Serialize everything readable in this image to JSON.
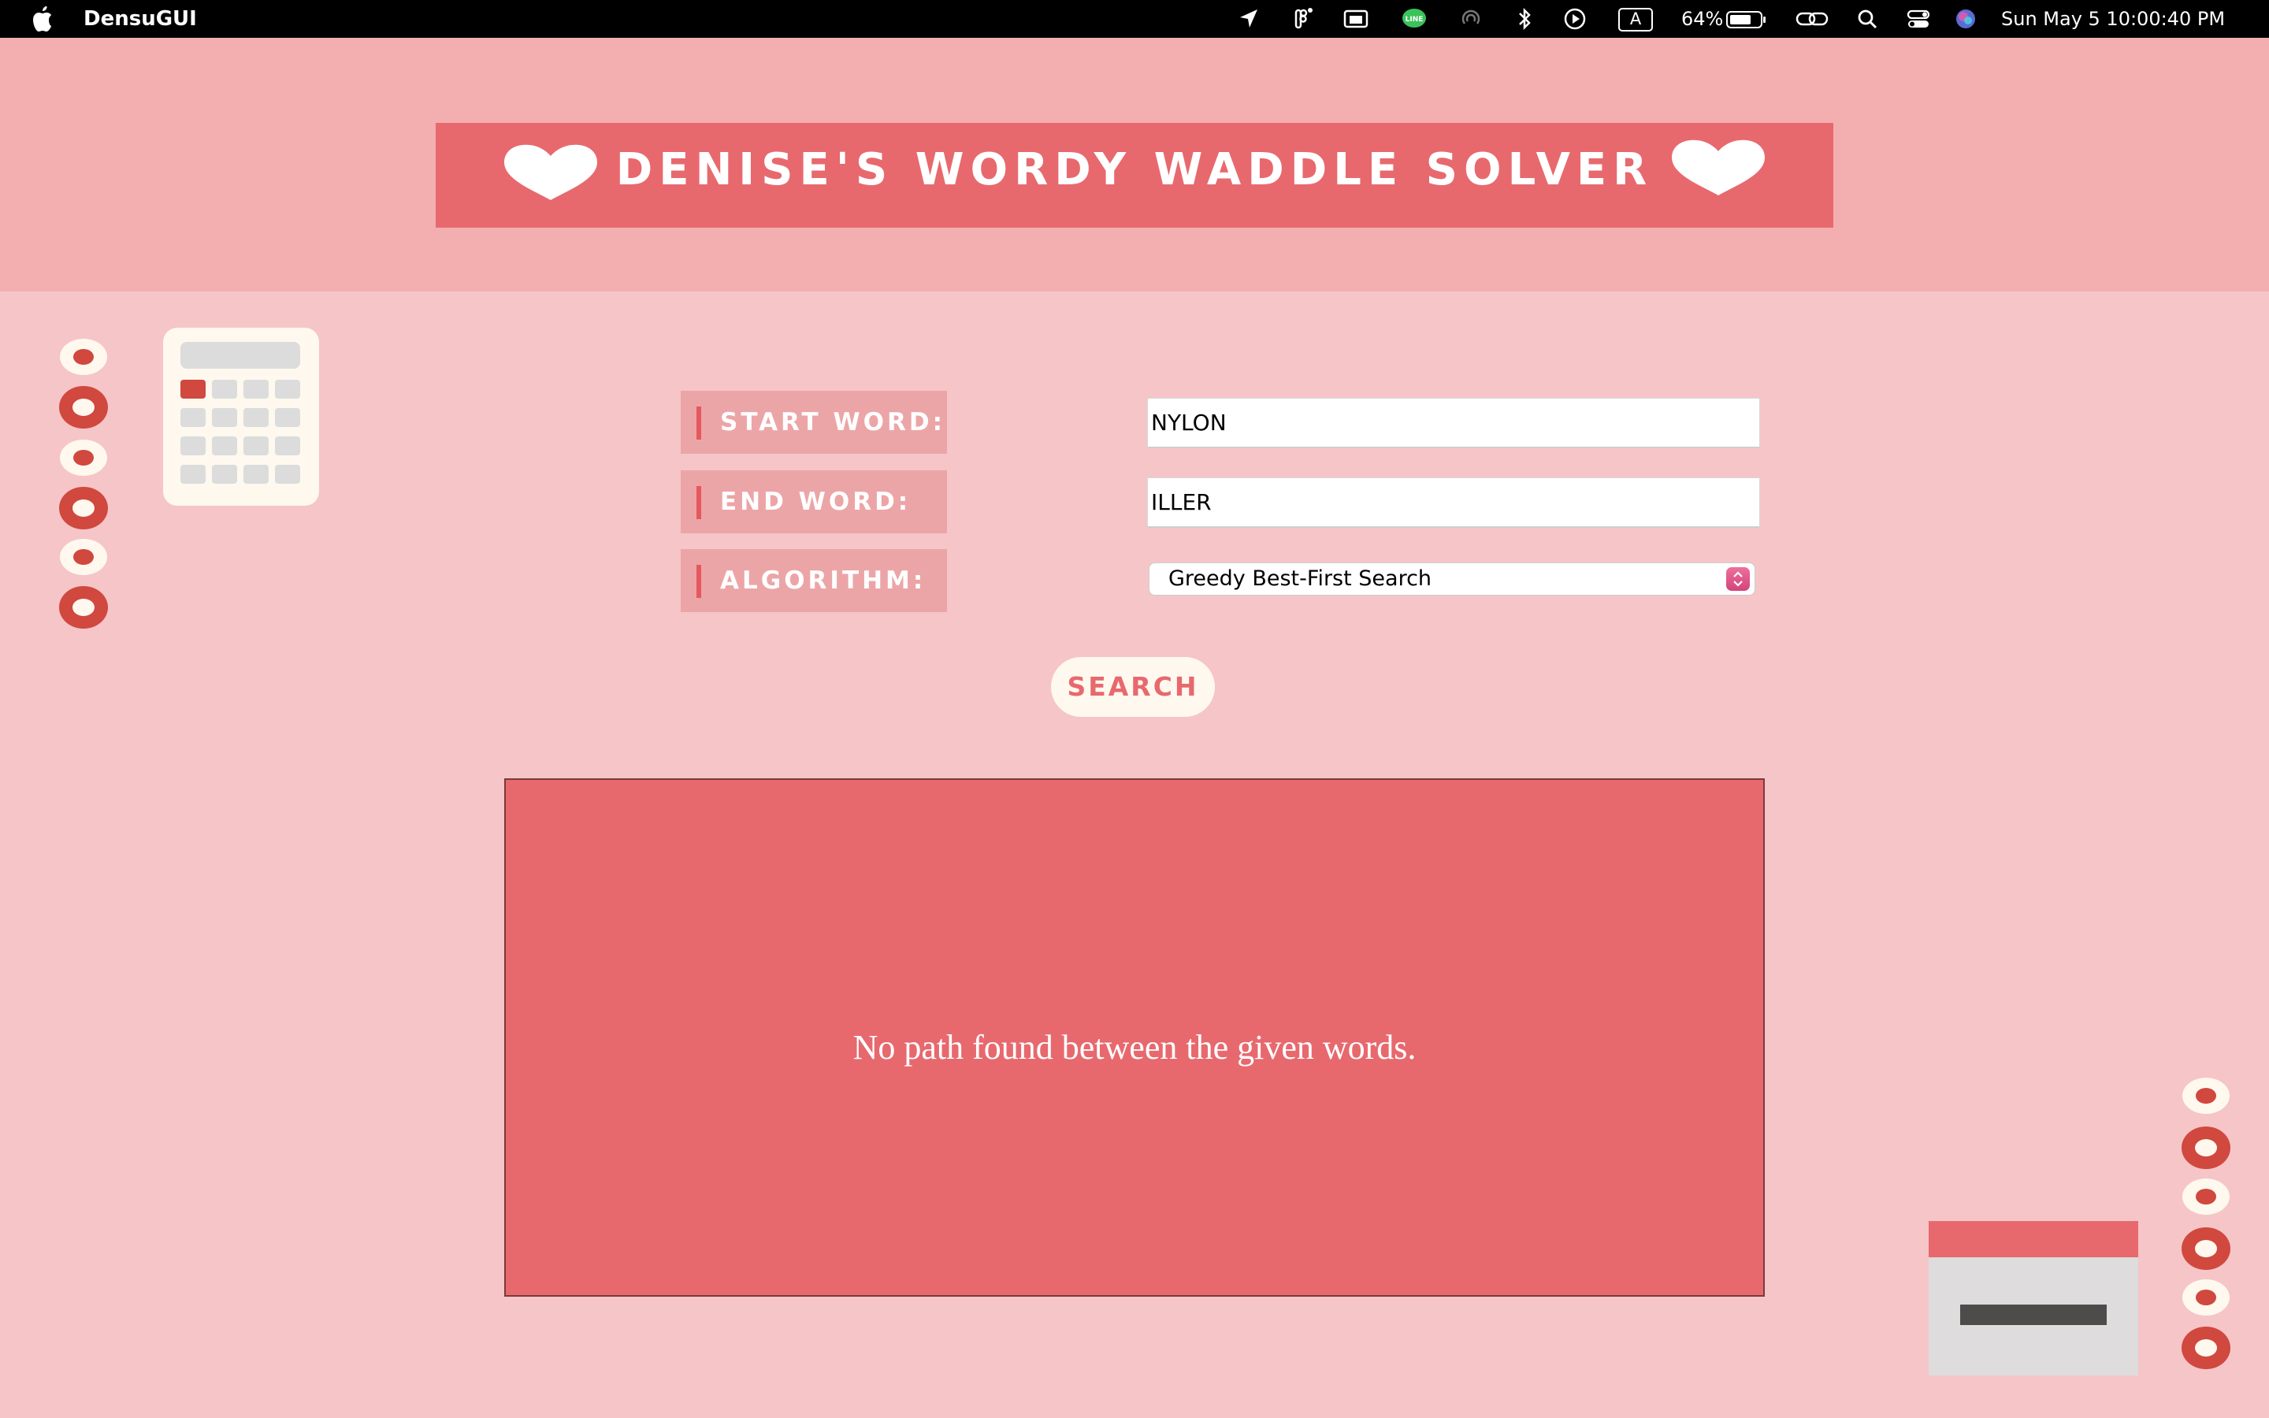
{
  "menubar": {
    "app_name": "DensuGUI",
    "battery": "64%",
    "datetime": "Sun May 5  10:00:40 PM",
    "icons": [
      "apple-icon",
      "location-arrow-icon",
      "figma-icon",
      "screen-mirroring-icon",
      "line-app-icon",
      "airdrop-icon",
      "bluetooth-icon",
      "play-circle-icon",
      "input-source-icon",
      "battery-icon",
      "link-icon",
      "spotlight-search-icon",
      "control-center-icon",
      "siri-icon"
    ],
    "input_source_letter": "A"
  },
  "header": {
    "title": "DENISE'S WORDY WADDLE SOLVER"
  },
  "form": {
    "start_label": "START WORD:",
    "start_value": "NYLON",
    "end_label": "END WORD:",
    "end_value": "ILLER",
    "algorithm_label": "ALGORITHM:",
    "algorithm_selected": "Greedy Best-First Search",
    "search_label": "SEARCH"
  },
  "result": {
    "message": "No path found between the given words."
  },
  "colors": {
    "page_background": "#f6c5c8",
    "header_background": "#f3aeb0",
    "banner": "#e7696e",
    "label_background": "#eca5a7",
    "accent_red": "#d0483e",
    "cream": "#fff8ef"
  }
}
